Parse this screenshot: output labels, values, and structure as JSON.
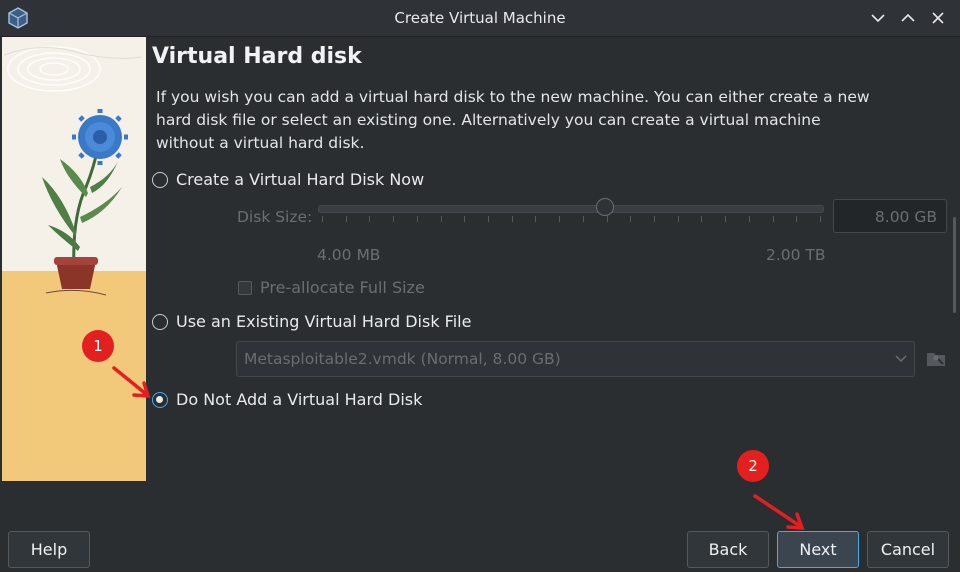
{
  "window": {
    "title": "Create Virtual Machine",
    "controls": [
      "chevron-down-icon",
      "chevron-up-icon",
      "close-icon"
    ]
  },
  "page": {
    "heading": "Virtual Hard disk",
    "description": "If you wish you can add a virtual hard disk to the new machine. You can either create a new hard disk file or select an existing one. Alternatively you can create a virtual machine without a virtual hard disk."
  },
  "options": {
    "create_now": {
      "label": "Create a Virtual Hard Disk Now",
      "checked": false
    },
    "use_existing": {
      "label": "Use an Existing Virtual Hard Disk File",
      "checked": false
    },
    "do_not_add": {
      "label": "Do Not Add a Virtual Hard Disk",
      "checked": true
    }
  },
  "disk_size": {
    "label": "Disk Size:",
    "value": "8.00 GB",
    "min_label": "4.00 MB",
    "max_label": "2.00 TB",
    "slider_fraction": 0.57,
    "preallocate_label": "Pre-allocate Full Size"
  },
  "existing_file": {
    "selected": "Metasploitable2.vmdk (Normal, 8.00 GB)"
  },
  "annotations": [
    {
      "number": "1"
    },
    {
      "number": "2"
    }
  ],
  "buttons": {
    "help": "Help",
    "back": "Back",
    "next": "Next",
    "cancel": "Cancel"
  },
  "colors": {
    "background": "#2b2e31",
    "accent": "#3daee9",
    "annotation_red": "#e02020",
    "art_yellow": "#f2c97a"
  }
}
